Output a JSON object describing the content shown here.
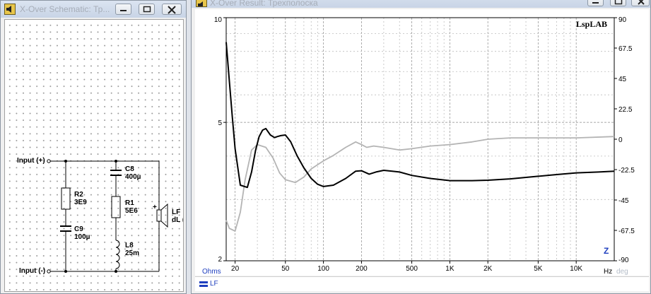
{
  "schematic_window": {
    "title": "X-Over Schematic: Тр...",
    "labels": {
      "input_plus": "Input (+)",
      "input_minus": "Input (-)",
      "r2_name": "R2",
      "r2_value": "3E9",
      "c9_name": "C9",
      "c9_value": "100µ",
      "c8_name": "C8",
      "c8_value": "400µ",
      "r1_name": "R1",
      "r1_value": "5E6",
      "l8_name": "L8",
      "l8_value": "25m",
      "lf_name": "LF",
      "lf_sub": "dL (",
      "plus_sign": "+"
    }
  },
  "result_window": {
    "title": "X-Over Result: Трехполоска",
    "brand": "LspLAB",
    "z_marker": "Z",
    "ohms_label": "Ohms",
    "deg_label": "deg",
    "hz_label": "Hz",
    "legend_label": "LF",
    "y_left_ticks": [
      "10",
      "5",
      "2"
    ],
    "y_right_ticks": [
      "90",
      "67.5",
      "45",
      "22.5",
      "0",
      "-22.5",
      "-45",
      "-67.5",
      "-90"
    ],
    "x_ticks": [
      "20",
      "50",
      "100",
      "200",
      "500",
      "1K",
      "2K",
      "5K",
      "10K"
    ]
  },
  "colors": {
    "impedance": "#000000",
    "phase": "#b4b4b4",
    "legend_blue": "#1f3fbf"
  },
  "chart_data": {
    "type": "line",
    "title": "",
    "x_scale": "log",
    "xlim": [
      17,
      20000
    ],
    "y_left": {
      "unit": "Ohms",
      "scale": "log",
      "ylim": [
        2,
        10
      ]
    },
    "y_right": {
      "unit": "deg",
      "ylim": [
        -90,
        90
      ]
    },
    "grid": true,
    "series": [
      {
        "name": "LF",
        "quantity": "impedance",
        "axis": "left",
        "x": [
          17,
          18,
          19,
          20,
          22,
          25,
          27,
          29,
          31,
          33,
          35,
          38,
          41,
          43,
          46,
          50,
          55,
          62,
          70,
          80,
          90,
          100,
          120,
          150,
          180,
          200,
          230,
          260,
          300,
          350,
          400,
          500,
          700,
          1000,
          1500,
          2000,
          3000,
          5000,
          7000,
          10000,
          15000,
          20000
        ],
        "y": [
          8.5,
          6.6,
          5.2,
          4.2,
          3.3,
          3.25,
          3.6,
          4.15,
          4.55,
          4.75,
          4.8,
          4.6,
          4.52,
          4.55,
          4.58,
          4.6,
          4.4,
          4.0,
          3.7,
          3.45,
          3.32,
          3.27,
          3.3,
          3.45,
          3.62,
          3.63,
          3.55,
          3.6,
          3.64,
          3.62,
          3.6,
          3.52,
          3.45,
          3.4,
          3.4,
          3.41,
          3.44,
          3.5,
          3.54,
          3.58,
          3.6,
          3.62
        ]
      },
      {
        "name": "",
        "quantity": "phase",
        "axis": "right",
        "x": [
          17,
          18,
          20,
          22,
          24,
          27,
          30,
          35,
          40,
          45,
          50,
          60,
          70,
          80,
          100,
          120,
          150,
          180,
          200,
          220,
          250,
          300,
          400,
          500,
          700,
          1000,
          1500,
          2000,
          3000,
          5000,
          10000,
          20000
        ],
        "y": [
          -60,
          -66,
          -68,
          -54,
          -30,
          -8,
          -4,
          -6,
          -14,
          -25,
          -30,
          -32,
          -28,
          -22,
          -16,
          -12,
          -6,
          -2,
          -4,
          -6,
          -5,
          -6,
          -8,
          -7,
          -5,
          -4,
          -2,
          0,
          1,
          1,
          1,
          2
        ]
      }
    ]
  }
}
